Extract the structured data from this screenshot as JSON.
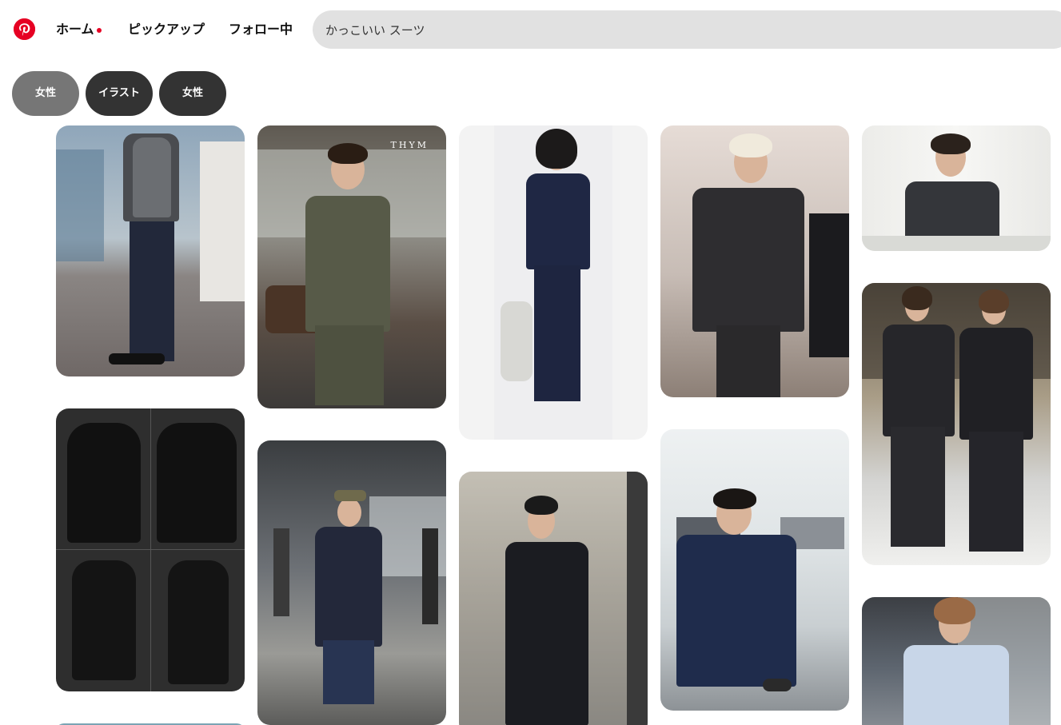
{
  "header": {
    "logo_icon": "pinterest-logo-icon",
    "nav": [
      {
        "label": "ホーム",
        "active_dot": true
      },
      {
        "label": "ピックアップ"
      },
      {
        "label": "フォロー中"
      }
    ],
    "search": {
      "value": "かっこいい スーツ"
    }
  },
  "filters": [
    {
      "label": "女性"
    },
    {
      "label": "イラスト"
    },
    {
      "label": "女性"
    }
  ],
  "pins": [
    {
      "overlay_text": ""
    },
    {
      "overlay_text": "THYM"
    }
  ],
  "colors": {
    "brand": "#e60023",
    "search_bg": "#e1e1e1",
    "chip_selected": "#767676",
    "chip": "#333333"
  }
}
